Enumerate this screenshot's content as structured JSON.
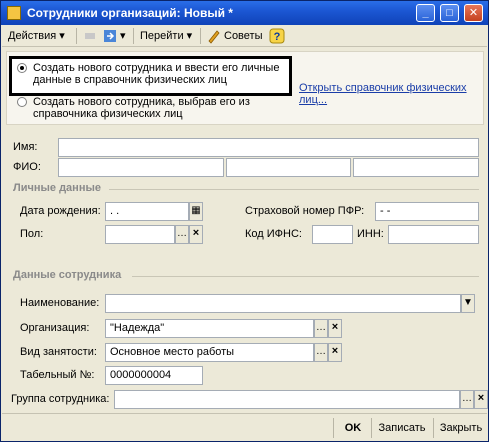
{
  "window": {
    "title": "Сотрудники организаций: Новый *"
  },
  "toolbar": {
    "actions_label": "Действия",
    "goto_label": "Перейти",
    "tips_label": "Советы",
    "help_label": "?"
  },
  "create_options": {
    "option_new": "Создать нового сотрудника и ввести его личные данные в справочник физических лиц",
    "option_pick": "Создать нового сотрудника, выбрав его из справочника физических лиц",
    "open_link": "Открыть справочник физических лиц..."
  },
  "name": {
    "first_label": "Имя:",
    "first_value": "",
    "fio_label": "ФИО:"
  },
  "personal": {
    "section": "Личные данные",
    "birth_label": "Дата рождения:",
    "birth_value": " .  .",
    "gender_label": "Пол:",
    "gender_value": "",
    "pfr_label": "Страховой номер ПФР:",
    "pfr_value": "   -   -",
    "ifns_label": "Код ИФНС:",
    "ifns_value": "",
    "inn_label": "ИНН:",
    "inn_value": ""
  },
  "employee": {
    "section": "Данные сотрудника",
    "name_label": "Наименование:",
    "name_value": "",
    "org_label": "Организация:",
    "org_value": "\"Надежда\"",
    "employment_label": "Вид занятости:",
    "employment_value": "Основное место работы",
    "tabnum_label": "Табельный №:",
    "tabnum_value": "0000000004",
    "group_label": "Группа сотрудника:",
    "group_value": ""
  },
  "footer": {
    "ok_label": "OK",
    "save_label": "Записать",
    "close_label": "Закрыть"
  },
  "colors": {
    "title_bar": "#1c57d4",
    "link": "#1a3da8",
    "window_bg": "#ece9d8"
  },
  "icons": [
    "app-icon",
    "minimize-icon",
    "maximize-icon",
    "close-icon",
    "goto-arrow-icon",
    "tips-icon",
    "help-icon",
    "calendar-icon",
    "ellipsis-icon",
    "clear-x-icon",
    "dropdown-arrow-icon"
  ]
}
